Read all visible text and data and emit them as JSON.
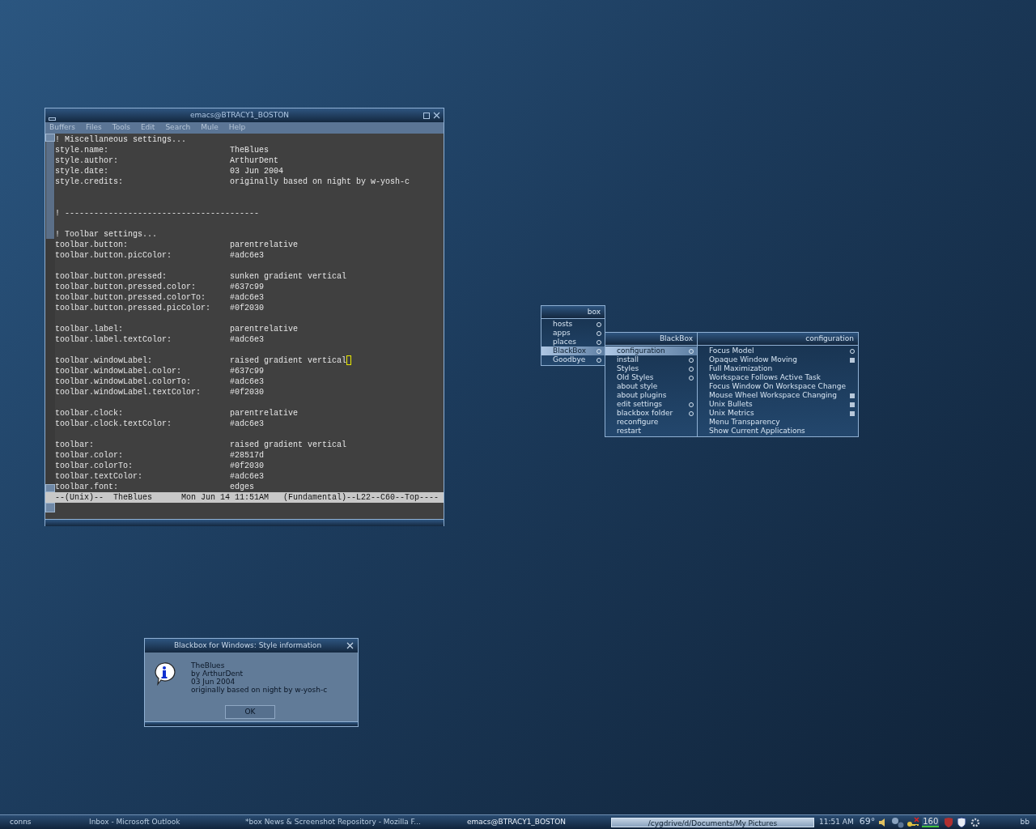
{
  "editor": {
    "title": "emacs@BTRACY1_BOSTON",
    "menu": [
      "Buffers",
      "Files",
      "Tools",
      "Edit",
      "Search",
      "Mule",
      "Help"
    ],
    "lines": [
      {
        "kind": "comment",
        "text": "! Miscellaneous settings..."
      },
      {
        "kind": "setting",
        "text": "style.name:",
        "value": "TheBlues"
      },
      {
        "kind": "setting",
        "text": "style.author:",
        "value": "ArthurDent"
      },
      {
        "kind": "setting",
        "text": "style.date:",
        "value": "03 Jun 2004"
      },
      {
        "kind": "setting",
        "text": "style.credits:",
        "value": "originally based on night by w-yosh-c"
      },
      {
        "kind": "blank"
      },
      {
        "kind": "blank"
      },
      {
        "kind": "comment",
        "text": "! ----------------------------------------"
      },
      {
        "kind": "blank"
      },
      {
        "kind": "comment",
        "text": "! Toolbar settings..."
      },
      {
        "kind": "setting",
        "text": "toolbar.button:",
        "value": "parentrelative"
      },
      {
        "kind": "setting",
        "text": "toolbar.button.picColor:",
        "value": "#adc6e3"
      },
      {
        "kind": "blank"
      },
      {
        "kind": "setting",
        "text": "toolbar.button.pressed:",
        "value": "sunken gradient vertical"
      },
      {
        "kind": "setting",
        "text": "toolbar.button.pressed.color:",
        "value": "#637c99"
      },
      {
        "kind": "setting",
        "text": "toolbar.button.pressed.colorTo:",
        "value": "#adc6e3"
      },
      {
        "kind": "setting",
        "text": "toolbar.button.pressed.picColor:",
        "value": "#0f2030"
      },
      {
        "kind": "blank"
      },
      {
        "kind": "setting",
        "text": "toolbar.label:",
        "value": "parentrelative"
      },
      {
        "kind": "setting",
        "text": "toolbar.label.textColor:",
        "value": "#adc6e3"
      },
      {
        "kind": "blank"
      },
      {
        "kind": "setting",
        "text": "toolbar.windowLabel:",
        "value": "raised gradient vertical",
        "cursor": true
      },
      {
        "kind": "setting",
        "text": "toolbar.windowLabel.color:",
        "value": "#637c99"
      },
      {
        "kind": "setting",
        "text": "toolbar.windowLabel.colorTo:",
        "value": "#adc6e3"
      },
      {
        "kind": "setting",
        "text": "toolbar.windowLabel.textColor:",
        "value": "#0f2030"
      },
      {
        "kind": "blank"
      },
      {
        "kind": "setting",
        "text": "toolbar.clock:",
        "value": "parentrelative"
      },
      {
        "kind": "setting",
        "text": "toolbar.clock.textColor:",
        "value": "#adc6e3"
      },
      {
        "kind": "blank"
      },
      {
        "kind": "setting",
        "text": "toolbar:",
        "value": "raised gradient vertical"
      },
      {
        "kind": "setting",
        "text": "toolbar.color:",
        "value": "#28517d"
      },
      {
        "kind": "setting",
        "text": "toolbar.colorTo:",
        "value": "#0f2030"
      },
      {
        "kind": "setting",
        "text": "toolbar.textColor:",
        "value": "#adc6e3"
      },
      {
        "kind": "setting",
        "text": "toolbar.font:",
        "value": "edges"
      }
    ],
    "mode_line": "--(Unix)--  TheBlues      Mon Jun 14 11:51AM   (Fundamental)--L22--C60--Top----"
  },
  "menus": [
    {
      "title": "box",
      "items": [
        {
          "label": "hosts",
          "kind": "submenu",
          "selected": false
        },
        {
          "label": "apps",
          "kind": "submenu",
          "selected": false
        },
        {
          "label": "places",
          "kind": "submenu",
          "selected": false
        },
        {
          "label": "BlackBox",
          "kind": "submenu",
          "selected": true
        },
        {
          "label": "Goodbye",
          "kind": "submenu",
          "selected": false
        }
      ]
    },
    {
      "title": "BlackBox",
      "items": [
        {
          "label": "configuration",
          "kind": "submenu",
          "selected": true
        },
        {
          "label": "install",
          "kind": "submenu",
          "selected": false
        },
        {
          "label": "Styles",
          "kind": "submenu",
          "selected": false
        },
        {
          "label": "Old Styles",
          "kind": "submenu",
          "selected": false
        },
        {
          "label": "about style",
          "kind": "plain",
          "selected": false
        },
        {
          "label": "about plugins",
          "kind": "plain",
          "selected": false
        },
        {
          "label": "edit settings",
          "kind": "submenu",
          "selected": false
        },
        {
          "label": "blackbox folder",
          "kind": "submenu",
          "selected": false
        },
        {
          "label": "reconfigure",
          "kind": "plain",
          "selected": false
        },
        {
          "label": "restart",
          "kind": "plain",
          "selected": false
        }
      ]
    },
    {
      "title": "configuration",
      "items": [
        {
          "label": "Focus Model",
          "kind": "submenu",
          "selected": false
        },
        {
          "label": "Opaque Window Moving",
          "kind": "option",
          "checked": true,
          "selected": false
        },
        {
          "label": "Full Maximization",
          "kind": "option",
          "checked": false,
          "selected": false
        },
        {
          "label": "Workspace Follows Active Task",
          "kind": "option",
          "checked": false,
          "selected": false
        },
        {
          "label": "Focus Window On Workspace Change",
          "kind": "option",
          "checked": false,
          "selected": false
        },
        {
          "label": "Mouse Wheel Workspace Changing",
          "kind": "option",
          "checked": true,
          "selected": false
        },
        {
          "label": "Unix Bullets",
          "kind": "option",
          "checked": true,
          "selected": false
        },
        {
          "label": "Unix Metrics",
          "kind": "option",
          "checked": true,
          "selected": false
        },
        {
          "label": "Menu Transparency",
          "kind": "option",
          "checked": false,
          "selected": false
        },
        {
          "label": "Show Current Applications",
          "kind": "option",
          "checked": false,
          "selected": false
        }
      ]
    }
  ],
  "dialog": {
    "title": "Blackbox for Windows: Style information",
    "lines": [
      "TheBlues",
      "by ArthurDent",
      "03 Jun 2004",
      "originally based on night by w-yosh-c"
    ],
    "button": "OK"
  },
  "taskbar": {
    "workspace": "conns",
    "tasks": [
      {
        "label": "Inbox - Microsoft Outlook",
        "selected": false
      },
      {
        "label": "*box News & Screenshot Repository - Mozilla F...",
        "selected": false
      },
      {
        "label": "emacs@BTRACY1_BOSTON",
        "selected": true
      }
    ],
    "path": "/cygdrive/d/Documents/My Pictures",
    "clock": "11:51 AM",
    "temperature": "69°",
    "tray_badge": "160",
    "end": "bb"
  }
}
